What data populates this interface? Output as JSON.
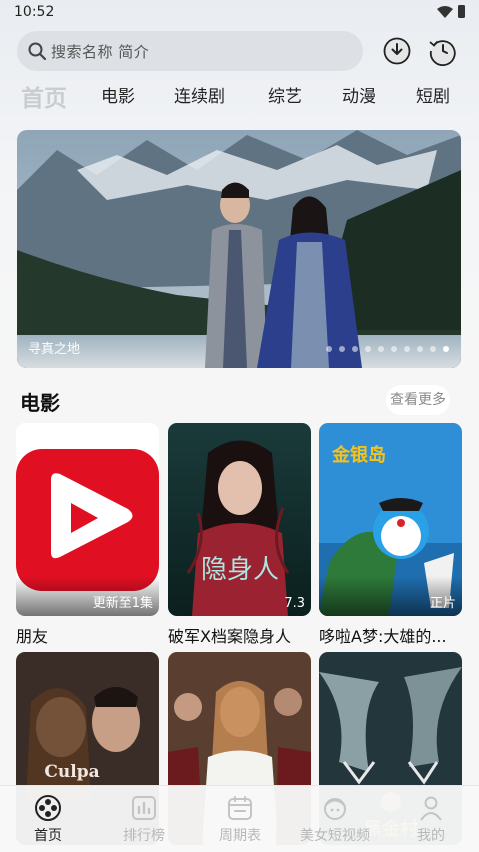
{
  "status": {
    "time": "10:52"
  },
  "search": {
    "placeholder": "搜索名称 简介"
  },
  "header": {
    "download_icon": "download-icon",
    "history_icon": "history-icon"
  },
  "tabs": [
    "首页",
    "电影",
    "连续剧",
    "综艺",
    "动漫",
    "短剧"
  ],
  "banner": {
    "title": "寻真之地",
    "dot_count": 10,
    "active_dot": 9
  },
  "section": {
    "title": "电影",
    "more": "查看更多"
  },
  "cards": [
    {
      "name": "朋友",
      "badge": "更新至1集"
    },
    {
      "name": "破军X档案隐身人",
      "badge": "7.3"
    },
    {
      "name": "哆啦A梦:大雄的...",
      "badge": "正片"
    },
    {
      "name": "",
      "badge": ""
    },
    {
      "name": "",
      "badge": ""
    },
    {
      "name": "",
      "badge": ""
    }
  ],
  "nav": [
    {
      "label": "首页",
      "icon": "film-reel-icon"
    },
    {
      "label": "排行榜",
      "icon": "chart-icon"
    },
    {
      "label": "周期表",
      "icon": "calendar-icon"
    },
    {
      "label": "美女短视频",
      "icon": "girl-face-icon"
    },
    {
      "label": "我的",
      "icon": "user-icon"
    }
  ],
  "colors": {
    "accent": "#e10f22",
    "active_tab": "#c9cdd2",
    "nav_inactive": "#b8b8b8"
  }
}
